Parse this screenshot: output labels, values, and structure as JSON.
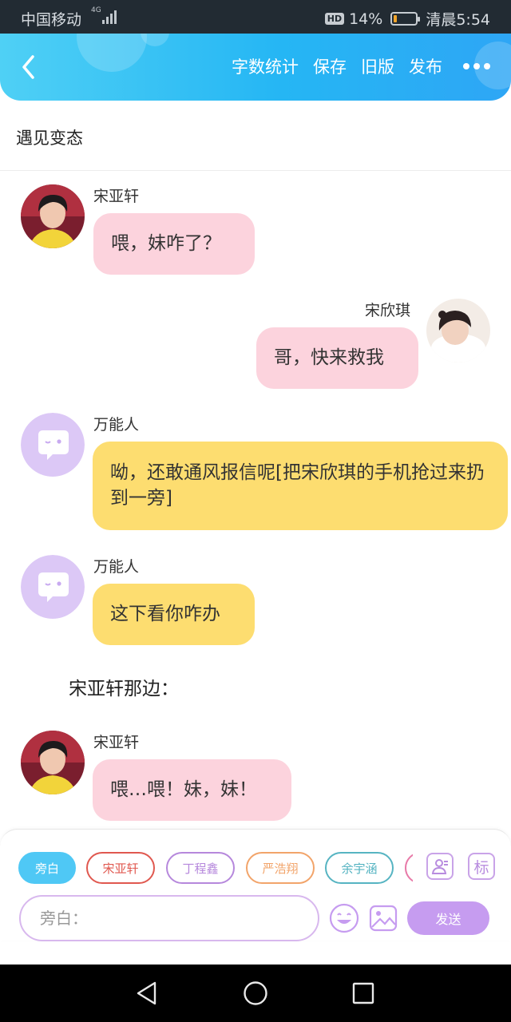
{
  "status_bar": {
    "carrier": "中国移动",
    "network": "4G",
    "hd": "HD",
    "battery_percent": "14%",
    "battery_level": 0.14,
    "time": "清晨5:54"
  },
  "header": {
    "back_icon": "chevron-left-icon",
    "actions": [
      "字数统计",
      "保存",
      "旧版",
      "发布"
    ],
    "more_icon": "more-dots-icon",
    "gradient_colors": [
      "#4fd0f5",
      "#2ea6f5"
    ]
  },
  "story_title": "遇见变态",
  "messages": [
    {
      "speaker": "宋亚轩",
      "text": "喂，妹咋了？"
    },
    {
      "speaker": "宋欣琪",
      "text": "哥，快来救我"
    },
    {
      "speaker": "万能人",
      "text": "呦，还敢通风报信呢[把宋欣琪的手机抢过来扔到一旁]"
    },
    {
      "speaker": "万能人",
      "text": "这下看你咋办"
    },
    {
      "speaker": "宋亚轩",
      "text": "喂…喂！妹，妹！"
    }
  ],
  "narration": "宋亚轩那边：",
  "colors": {
    "pink_bubble": "#fcd3dd",
    "yellow_bubble": "#fddd70",
    "accent_blue": "#4fc8f5",
    "accent_purple": "#c69cf0"
  },
  "bottom": {
    "role_chips": [
      {
        "label": "旁白",
        "color": "#4fc8f5"
      },
      {
        "label": "宋亚轩",
        "color": "#e0584f"
      },
      {
        "label": "丁程鑫",
        "color": "#b688dc"
      },
      {
        "label": "严浩翔",
        "color": "#f2a46a"
      },
      {
        "label": "余宇涵",
        "color": "#56b4c2"
      }
    ],
    "contact_icon": "add-contact-icon",
    "tag_label": "标",
    "input_placeholder": "旁白：",
    "emoji_icon": "emoji-icon",
    "image_icon": "image-icon",
    "send_label": "发送"
  },
  "nav_bar": [
    "back-icon",
    "home-icon",
    "recents-icon"
  ]
}
